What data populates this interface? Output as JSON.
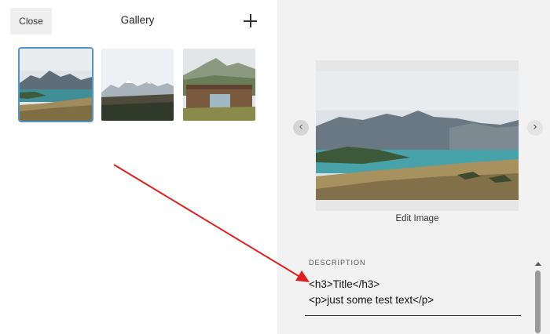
{
  "left_panel": {
    "close_label": "Close",
    "title": "Gallery",
    "add_icon": "plus-icon",
    "thumbnails": [
      {
        "subject": "mountain lake landscape",
        "selected": true
      },
      {
        "subject": "snowy mountains over moorland",
        "selected": false
      },
      {
        "subject": "wooden cabin in hills",
        "selected": false
      }
    ]
  },
  "right_panel": {
    "prev_icon": "chevron-left-icon",
    "next_icon": "chevron-right-icon",
    "prev_glyph": "‹",
    "next_glyph": "›",
    "edit_image_label": "Edit Image",
    "description_label": "DESCRIPTION",
    "description_lines": [
      "<h3>Title</h3>",
      "<p>just some test text</p>"
    ]
  },
  "colors": {
    "accent": "#4f94d4",
    "annotation_arrow": "#e02020",
    "right_panel_bg": "#f2f2f2"
  }
}
